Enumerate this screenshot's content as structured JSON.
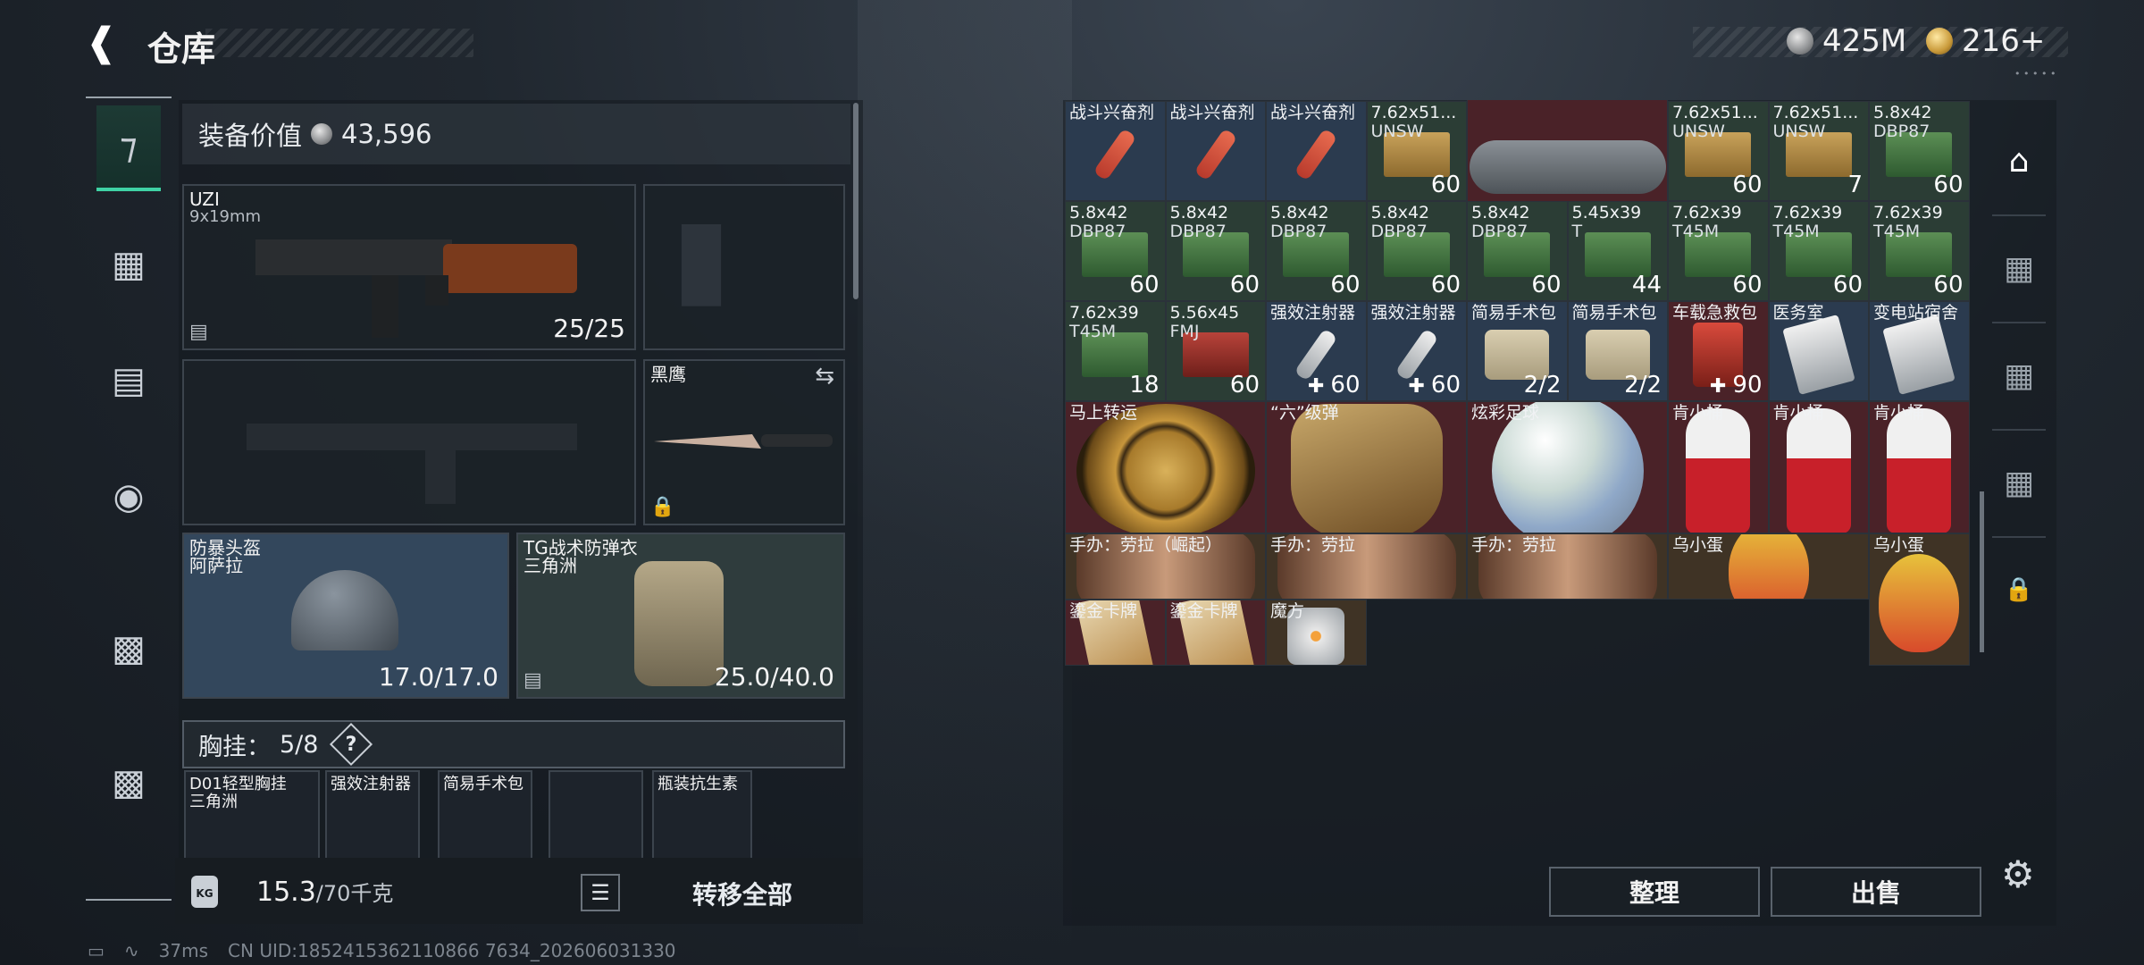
{
  "header": {
    "title": "仓库",
    "back_icon": "back-arrow-icon"
  },
  "currency": [
    {
      "icon": "silver-coin-icon",
      "value": "425M"
    },
    {
      "icon": "gold-coin-icon",
      "value": "216+"
    }
  ],
  "currency_tiny": "• • • • •",
  "left_nav": [
    "pistol-icon",
    "vest-icon",
    "backpack-icon",
    "pouch-icon",
    "clipboard-icon",
    "toolbox-icon"
  ],
  "equipment": {
    "value_label": "装备价值",
    "value": "43,596",
    "primary": {
      "name": "UZI",
      "caliber": "9x19mm",
      "ammo": "25/25"
    },
    "melee": {
      "name": "黑鹰"
    },
    "helmet": {
      "name": "防暴头盔",
      "sub": "阿萨拉",
      "durability": "17.0/17.0"
    },
    "armor": {
      "name": "TG战术防弹衣",
      "sub": "三角洲",
      "durability": "25.0/40.0"
    },
    "chest_rig": {
      "label": "胸挂：",
      "count": "5/8",
      "help": "?"
    },
    "chest_slots": [
      {
        "name": "D01轻型胸挂",
        "sub": "三角洲"
      },
      {
        "name": "强效注射器",
        "sub": ""
      },
      {
        "name": "简易手术包",
        "sub": ""
      },
      {
        "name": "",
        "sub": ""
      },
      {
        "name": "瓶装抗生素",
        "sub": ""
      }
    ]
  },
  "bottom": {
    "weight_value": "15.3",
    "weight_max": "/70千克",
    "transfer_all": "转移全部",
    "list_icon": "list-icon"
  },
  "status": {
    "ping": "37ms",
    "uid": "CN UID:1852415362110866 7634_202606031330"
  },
  "grid": {
    "row1": [
      {
        "name": "战斗兴奋剂",
        "sub": "",
        "qty": "",
        "type": "pen",
        "bg": "bl"
      },
      {
        "name": "战斗兴奋剂",
        "sub": "",
        "qty": "",
        "type": "pen",
        "bg": "bl"
      },
      {
        "name": "战斗兴奋剂",
        "sub": "",
        "qty": "",
        "type": "pen",
        "bg": "bl"
      },
      {
        "name": "7.62x51...",
        "sub": "UNSW",
        "qty": "60",
        "type": "box",
        "bg": "g"
      },
      {
        "name": "",
        "sub": "",
        "qty": "",
        "type": "drone",
        "bg": "rd"
      },
      {
        "name": "7.62x51...",
        "sub": "UNSW",
        "qty": "60",
        "type": "box",
        "bg": "g"
      },
      {
        "name": "7.62x51...",
        "sub": "UNSW",
        "qty": "7",
        "type": "box",
        "bg": "g"
      },
      {
        "name": "5.8x42",
        "sub": "DBP87",
        "qty": "60",
        "type": "boxg",
        "bg": "g"
      }
    ],
    "row2": [
      {
        "name": "5.8x42",
        "sub": "DBP87",
        "qty": "60"
      },
      {
        "name": "5.8x42",
        "sub": "DBP87",
        "qty": "60"
      },
      {
        "name": "5.8x42",
        "sub": "DBP87",
        "qty": "60"
      },
      {
        "name": "5.8x42",
        "sub": "DBP87",
        "qty": "60"
      },
      {
        "name": "5.8x42",
        "sub": "DBP87",
        "qty": "60"
      },
      {
        "name": "5.45x39",
        "sub": "T",
        "qty": "44"
      },
      {
        "name": "7.62x39",
        "sub": "T45M",
        "qty": "60"
      },
      {
        "name": "7.62x39",
        "sub": "T45M",
        "qty": "60"
      },
      {
        "name": "7.62x39",
        "sub": "T45M",
        "qty": "60"
      }
    ],
    "row3": [
      {
        "name": "7.62x39",
        "sub": "T45M",
        "qty": "18",
        "type": "boxg",
        "bg": "g"
      },
      {
        "name": "5.56x45",
        "sub": "FMJ",
        "qty": "60",
        "type": "boxr",
        "bg": "g"
      },
      {
        "name": "强效注射器",
        "sub": "",
        "qty": "60",
        "plus": true,
        "type": "penw",
        "bg": "bl"
      },
      {
        "name": "强效注射器",
        "sub": "",
        "qty": "60",
        "plus": true,
        "type": "penw",
        "bg": "bl"
      },
      {
        "name": "简易手术包",
        "sub": "",
        "qty": "2/2",
        "type": "bag",
        "bg": "bl"
      },
      {
        "name": "简易手术包",
        "sub": "",
        "qty": "2/2",
        "type": "bag",
        "bg": "bl"
      },
      {
        "name": "车载急救包",
        "sub": "",
        "qty": "90",
        "plus": true,
        "type": "red",
        "bg": "rd"
      },
      {
        "name": "医务室",
        "sub": "",
        "qty": "",
        "type": "med",
        "bg": "bl"
      },
      {
        "name": "变电站宿舍",
        "sub": "",
        "qty": "",
        "type": "med",
        "bg": "bl"
      }
    ],
    "row4": [
      {
        "name": "马上转运",
        "type": "disc"
      },
      {
        "name": "“六”级弹",
        "type": "hand"
      },
      {
        "name": "炫彩足球",
        "type": "ball"
      },
      {
        "name": "肯小桶",
        "type": "kfc"
      },
      {
        "name": "肯小桶",
        "type": "kfc"
      },
      {
        "name": "肯小桶",
        "type": "kfc"
      }
    ],
    "row5": [
      {
        "name": "手办：劳拉（崛起）",
        "type": "doll"
      },
      {
        "name": "手办：劳拉",
        "type": "doll"
      },
      {
        "name": "手办：劳拉",
        "type": "doll"
      },
      {
        "name": "乌小蛋",
        "type": "egg"
      },
      {
        "name": "乌小蛋",
        "type": "egg"
      }
    ],
    "row6": [
      {
        "name": "鎏金卡牌",
        "type": "card"
      },
      {
        "name": "鎏金卡牌",
        "type": "card"
      },
      {
        "name": "魔方",
        "type": "cube"
      }
    ]
  },
  "right_nav": [
    "safehouse-icon",
    "case-v-icon",
    "case-ii-icon",
    "case-iv-icon",
    "lock-icon"
  ],
  "buttons": {
    "organize": "整理",
    "sell": "出售",
    "settings_icon": "gear-icon"
  }
}
